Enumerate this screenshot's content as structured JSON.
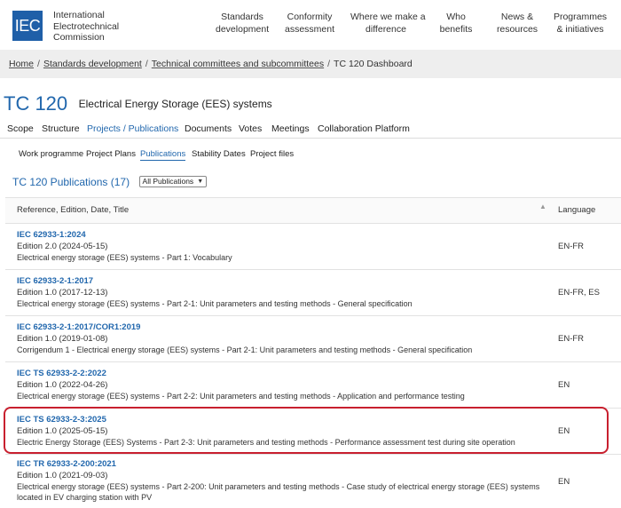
{
  "brand": {
    "logo_text": "IEC",
    "org_line1": "International",
    "org_line2": "Electrotechnical",
    "org_line3": "Commission"
  },
  "nav": [
    {
      "line1": "Standards",
      "line2": "development"
    },
    {
      "line1": "Conformity",
      "line2": "assessment"
    },
    {
      "line1": "Where we make a",
      "line2": "difference"
    },
    {
      "line1": "Who",
      "line2": "benefits"
    },
    {
      "line1": "News &",
      "line2": "resources"
    },
    {
      "line1": "Programmes",
      "line2": "& initiatives"
    }
  ],
  "breadcrumb": {
    "items": [
      "Home",
      "Standards development",
      "Technical committees and subcommittees"
    ],
    "separator": "/",
    "current": "TC 120 Dashboard"
  },
  "committee": {
    "code": "TC 120",
    "name": "Electrical Energy Storage (EES) systems"
  },
  "main_tabs": [
    "Scope",
    "Structure",
    "Projects / Publications",
    "Documents",
    "Votes",
    "Meetings",
    "Collaboration Platform"
  ],
  "sub_tabs": [
    "Work programme",
    "Project Plans",
    "Publications",
    "Stability Dates",
    "Project files"
  ],
  "publications": {
    "title": "TC 120 Publications (17)",
    "filter_value": "All Publications"
  },
  "table": {
    "col_ref": "Reference, Edition, Date, Title",
    "col_lang": "Language",
    "rows": [
      {
        "ref": "IEC 62933-1:2024",
        "edition": "Edition 2.0 (2024-05-15)",
        "title": "Electrical energy storage (EES) systems - Part 1: Vocabulary",
        "lang": "EN-FR"
      },
      {
        "ref": "IEC 62933-2-1:2017",
        "edition": "Edition 1.0 (2017-12-13)",
        "title": "Electrical energy storage (EES) systems - Part 2-1: Unit parameters and testing methods - General specification",
        "lang": "EN-FR, ES"
      },
      {
        "ref": "IEC 62933-2-1:2017/COR1:2019",
        "edition": "Edition 1.0 (2019-01-08)",
        "title": "Corrigendum 1 - Electrical energy storage (EES) systems - Part 2-1: Unit parameters and testing methods - General specification",
        "lang": "EN-FR"
      },
      {
        "ref": "IEC TS 62933-2-2:2022",
        "edition": "Edition 1.0 (2022-04-26)",
        "title": "Electrical energy storage (EES) systems - Part 2-2: Unit parameters and testing methods - Application and performance testing",
        "lang": "EN"
      },
      {
        "ref": "IEC TS 62933-2-3:2025",
        "edition": "Edition 1.0 (2025-05-15)",
        "title": "Electric Energy Storage (EES) Systems - Part 2-3: Unit parameters and testing methods - Performance assessment test during site operation",
        "lang": "EN"
      },
      {
        "ref": "IEC TR 62933-2-200:2021",
        "edition": "Edition 1.0 (2021-09-03)",
        "title": "Electrical energy storage (EES) systems - Part 2-200: Unit parameters and testing methods - Case study of electrical energy storage (EES) systems located in EV charging station with PV",
        "lang": "EN"
      }
    ]
  },
  "colors": {
    "accent": "#2167ad",
    "highlight_border": "#c8202f",
    "breadcrumb_bg": "#eeeeee"
  }
}
